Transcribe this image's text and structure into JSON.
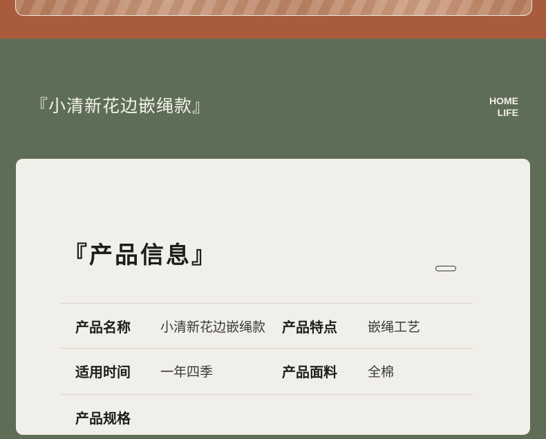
{
  "section_title": "『小清新花边嵌绳款』",
  "brand": {
    "line1": "HOME",
    "line2": "LIFE"
  },
  "card": {
    "title": "『产品信息』"
  },
  "specs": [
    {
      "label1": "产品名称",
      "value1": "小清新花边嵌绳款",
      "label2": "产品特点",
      "value2": "嵌绳工艺"
    },
    {
      "label1": "适用时间",
      "value1": "一年四季",
      "label2": "产品面料",
      "value2": "全棉"
    },
    {
      "label1": "产品规格",
      "value1": "",
      "label2": "",
      "value2": ""
    }
  ],
  "colors": {
    "background": "#5e6e56",
    "top_band": "#a85b3d",
    "card": "#f1efe9",
    "text_light": "#f4f1ea",
    "text_dark": "#1d1d1b"
  }
}
